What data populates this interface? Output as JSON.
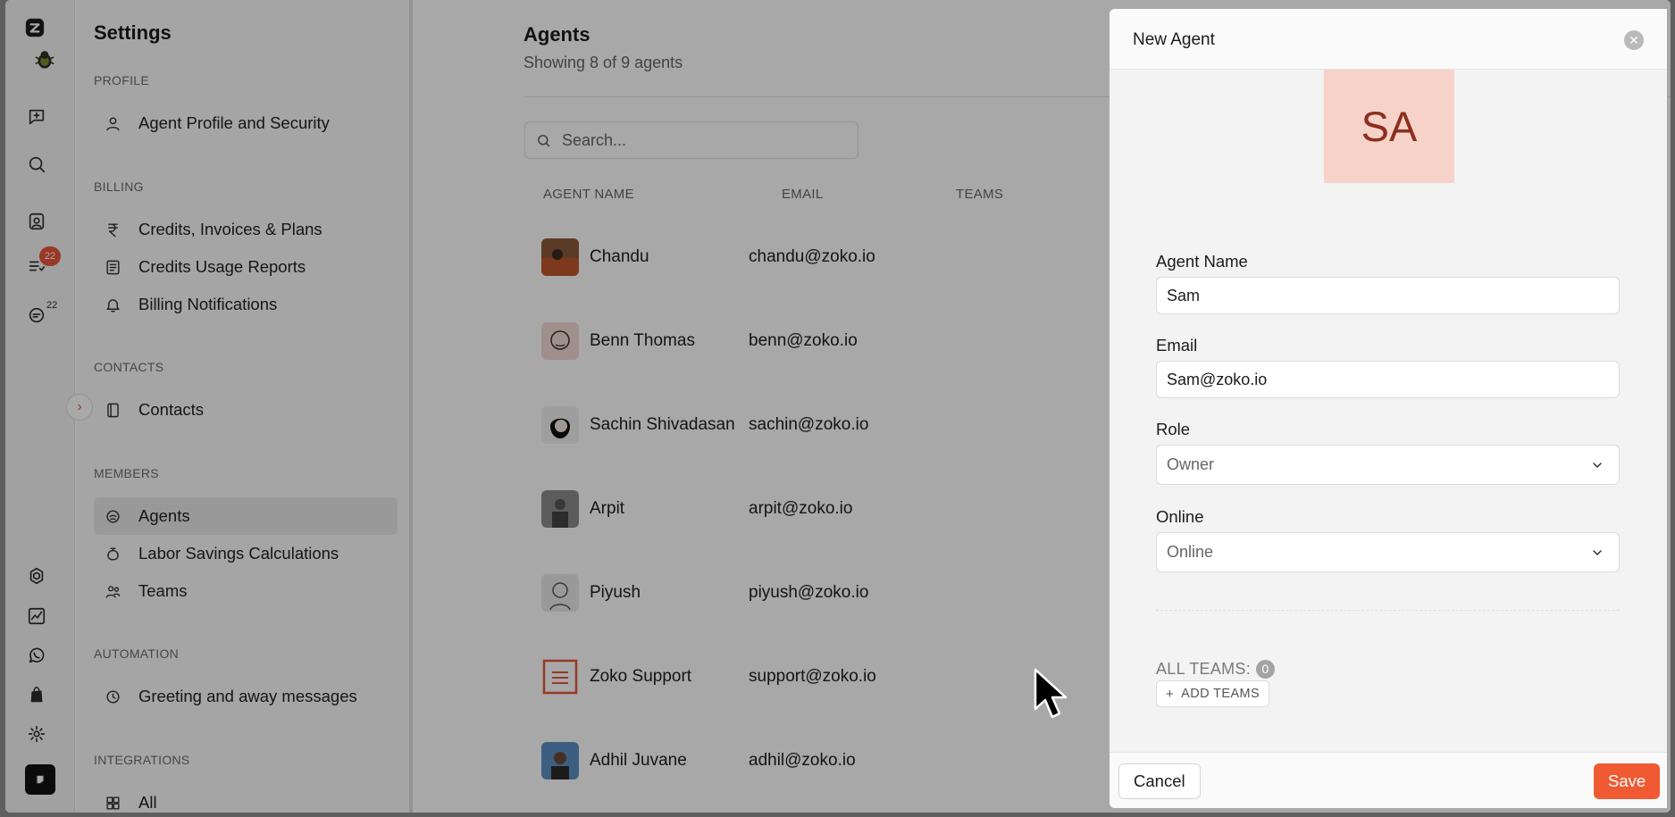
{
  "settings_nav": {
    "title": "Settings",
    "sections": [
      {
        "label": "PROFILE",
        "items": [
          {
            "label": "Agent Profile and Security",
            "icon": "user-icon"
          }
        ]
      },
      {
        "label": "BILLING",
        "items": [
          {
            "label": "Credits, Invoices & Plans",
            "icon": "rupee-icon"
          },
          {
            "label": "Credits Usage Reports",
            "icon": "report-icon"
          },
          {
            "label": "Billing Notifications",
            "icon": "bell-icon"
          }
        ]
      },
      {
        "label": "CONTACTS",
        "items": [
          {
            "label": "Contacts",
            "icon": "contacts-book-icon"
          }
        ]
      },
      {
        "label": "MEMBERS",
        "items": [
          {
            "label": "Agents",
            "icon": "agent-icon",
            "active": true
          },
          {
            "label": "Labor Savings Calculations",
            "icon": "savings-icon"
          },
          {
            "label": "Teams",
            "icon": "teams-icon"
          }
        ]
      },
      {
        "label": "AUTOMATION",
        "items": [
          {
            "label": "Greeting and away messages",
            "icon": "clock-icon"
          }
        ]
      },
      {
        "label": "INTEGRATIONS",
        "items": [
          {
            "label": "All",
            "icon": "grid-icon"
          }
        ]
      }
    ]
  },
  "rail": {
    "badge_count": "22",
    "mention_count": "22",
    "accent": "#e8553b"
  },
  "main": {
    "title": "Agents",
    "subtitle": "Showing 8 of 9 agents",
    "search_placeholder": "Search...",
    "columns": [
      "AGENT NAME",
      "EMAIL",
      "TEAMS"
    ],
    "rows": [
      {
        "name": "Chandu",
        "email": "chandu@zoko.io"
      },
      {
        "name": "Benn Thomas",
        "email": "benn@zoko.io"
      },
      {
        "name": "Sachin Shivadasan",
        "email": "sachin@zoko.io"
      },
      {
        "name": "Arpit",
        "email": "arpit@zoko.io"
      },
      {
        "name": "Piyush",
        "email": "piyush@zoko.io"
      },
      {
        "name": "Zoko Support",
        "email": "support@zoko.io"
      },
      {
        "name": "Adhil Juvane",
        "email": "adhil@zoko.io"
      }
    ]
  },
  "drawer": {
    "title": "New Agent",
    "avatar_initials": "SA",
    "avatar_bg": "#f6d2c9",
    "name_label": "Agent Name",
    "name_value": "Sam",
    "email_label": "Email",
    "email_value": "Sam@zoko.io",
    "role_label": "Role",
    "role_value": "Owner",
    "online_label": "Online",
    "online_value": "Online",
    "teams_label": "ALL TEAMS:",
    "teams_count": "0",
    "add_teams_label": "ADD TEAMS",
    "add_teams_plus": "+",
    "cancel_label": "Cancel",
    "save_label": "Save",
    "save_color": "#ef5a33"
  }
}
